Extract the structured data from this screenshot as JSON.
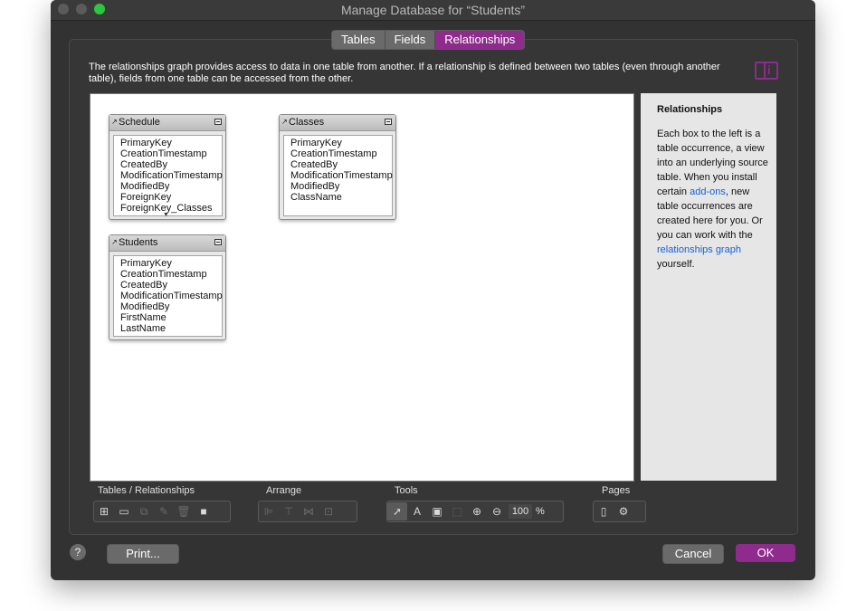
{
  "window": {
    "title": "Manage Database for “Students”"
  },
  "tabs": [
    {
      "label": "Tables",
      "active": false
    },
    {
      "label": "Fields",
      "active": false
    },
    {
      "label": "Relationships",
      "active": true
    }
  ],
  "description": "The relationships graph provides access to data in one table from another. If a relationship is defined between two tables (even through another table), fields from one table can be accessed from the other.",
  "graph": {
    "tables": [
      {
        "name": "Schedule",
        "fields": [
          "PrimaryKey",
          "CreationTimestamp",
          "CreatedBy",
          "ModificationTimestamp",
          "ModifiedBy",
          "ForeignKey",
          "ForeignKey_Classes"
        ]
      },
      {
        "name": "Classes",
        "fields": [
          "PrimaryKey",
          "CreationTimestamp",
          "CreatedBy",
          "ModificationTimestamp",
          "ModifiedBy",
          "ClassName"
        ]
      },
      {
        "name": "Students",
        "fields": [
          "PrimaryKey",
          "CreationTimestamp",
          "CreatedBy",
          "ModificationTimestamp",
          "ModifiedBy",
          "FirstName",
          "LastName"
        ]
      }
    ]
  },
  "sidebar": {
    "title": "Relationships",
    "text_1": "Each box to the left is a table occurrence, a view into an underlying source table. When you install certain ",
    "link_1": "add-ons",
    "text_2": ", new table occurrences are created here for you. Or you can work with the ",
    "link_2": "relationships graph",
    "text_3": " yourself."
  },
  "toolbar": {
    "groups": {
      "tables_relationships": "Tables / Relationships",
      "arrange": "Arrange",
      "tools": "Tools",
      "pages": "Pages"
    },
    "zoom": "100",
    "zoom_unit": "%"
  },
  "footer": {
    "help": "?",
    "print": "Print...",
    "cancel": "Cancel",
    "ok": "OK"
  },
  "colors": {
    "accent": "#8e2b8c",
    "link": "#1462d6"
  }
}
